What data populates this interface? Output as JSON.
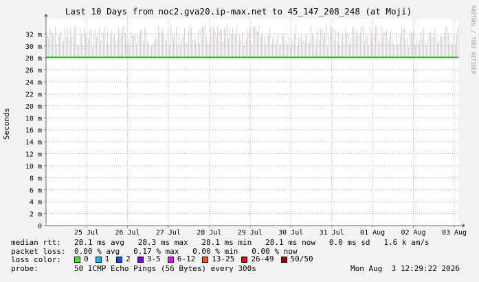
{
  "chart_data": {
    "type": "line",
    "title": "Last 10 Days from noc2.gva20.ip-max.net to 45_147_208_248 (at Moji)",
    "ylabel": "Seconds",
    "y_unit": "ms",
    "ylim": [
      0,
      34
    ],
    "yticks": [
      0,
      2,
      4,
      6,
      8,
      10,
      12,
      14,
      16,
      18,
      20,
      22,
      24,
      26,
      28,
      30,
      32
    ],
    "ytick_labels": [
      "0",
      "2 m",
      "4 m",
      "6 m",
      "8 m",
      "10 m",
      "12 m",
      "14 m",
      "16 m",
      "18 m",
      "20 m",
      "22 m",
      "24 m",
      "26 m",
      "28 m",
      "30 m",
      "32 m"
    ],
    "xticks": [
      "25 Jul",
      "26 Jul",
      "27 Jul",
      "28 Jul",
      "29 Jul",
      "30 Jul",
      "31 Jul",
      "01 Aug",
      "02 Aug",
      "03 Aug"
    ],
    "grid": true,
    "series": [
      {
        "name": "median rtt",
        "values": [
          28.1,
          28.1,
          28.1,
          28.1,
          28.1,
          28.1,
          28.1,
          28.1,
          28.1,
          28.1
        ],
        "color": "#00cc00"
      }
    ],
    "smoke_range_ms": [
      28.0,
      33.5
    ],
    "smoke_color": "#d7d7d7"
  },
  "watermark": "RRDTOOL / TOBI OETIKER",
  "stats": {
    "rtt_label": "median rtt:",
    "rtt_text": "28.1 ms avg   28.3 ms max   28.1 ms min   28.1 ms now   0.0 ms sd   1.6 k am/s",
    "loss_label": "packet loss:",
    "loss_text": "0.00 % avg   0.17 % max   0.00 % min   0.00 % now",
    "color_label": "loss color:",
    "probe_label": "probe:",
    "probe_text": "50 ICMP Echo Pings (56 Bytes) every 300s",
    "timestamp": "Mon Aug  3 12:29:22 2026"
  },
  "loss_colors": [
    {
      "label": "0",
      "color": "#26ff00"
    },
    {
      "label": "1",
      "color": "#00b8ff"
    },
    {
      "label": "2",
      "color": "#0059ff"
    },
    {
      "label": "3-5",
      "color": "#7e00ff"
    },
    {
      "label": "6-12",
      "color": "#ff00ff"
    },
    {
      "label": "13-25",
      "color": "#ff5500"
    },
    {
      "label": "26-49",
      "color": "#ff0000"
    },
    {
      "label": "50/50",
      "color": "#a10000"
    }
  ]
}
